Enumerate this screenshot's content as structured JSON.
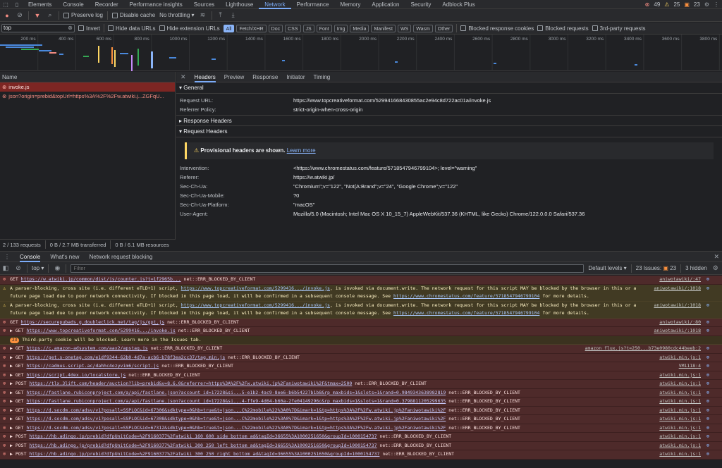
{
  "tabs": [
    "Elements",
    "Console",
    "Recorder",
    "Performance insights",
    "Sources",
    "Lighthouse",
    "Network",
    "Performance",
    "Memory",
    "Application",
    "Security",
    "Adblock Plus"
  ],
  "tab_active": "Network",
  "issues": {
    "errors": "49",
    "warnings": "25",
    "info": "23"
  },
  "toolbar": {
    "preserve_log": "Preserve log",
    "disable_cache": "Disable cache",
    "throttling": "No throttling"
  },
  "filter": {
    "value": "top",
    "invert": "Invert",
    "hide_data_urls": "Hide data URLs",
    "hide_extension_urls": "Hide extension URLs",
    "types": [
      "All",
      "Fetch/XHR",
      "Doc",
      "CSS",
      "JS",
      "Font",
      "Img",
      "Media",
      "Manifest",
      "WS",
      "Wasm",
      "Other"
    ],
    "blocked_response_cookies": "Blocked response cookies",
    "blocked_requests": "Blocked requests",
    "third_party": "3rd-party requests"
  },
  "timeline_ticks": [
    "200 ms",
    "400 ms",
    "600 ms",
    "800 ms",
    "1000 ms",
    "1200 ms",
    "1400 ms",
    "1600 ms",
    "1800 ms",
    "2000 ms",
    "2200 ms",
    "2400 ms",
    "2600 ms",
    "2800 ms",
    "3000 ms",
    "3200 ms",
    "3400 ms",
    "3600 ms",
    "3800 ms"
  ],
  "requests": {
    "header": "Name",
    "items": [
      {
        "name": "invoke.js"
      },
      {
        "name": "json?origin=prebid&topUrl=https%3A%2F%2Fw.atwiki.j...ZGFqU..."
      }
    ],
    "summary": {
      "requests": "2 / 133 requests",
      "transferred": "0 B / 2.7 MB transferred",
      "resources": "0 B / 6.1 MB resources"
    }
  },
  "details": {
    "tabs": [
      "Headers",
      "Preview",
      "Response",
      "Initiator",
      "Timing"
    ],
    "general_title": "General",
    "request_url_label": "Request URL:",
    "request_url": "https://www.topcreativeformat.com/529941668430855ac2e94c8d722ac01a/invoke.js",
    "referrer_policy_label": "Referrer Policy:",
    "referrer_policy": "strict-origin-when-cross-origin",
    "response_headers_title": "Response Headers",
    "request_headers_title": "Request Headers",
    "provisional_text": "Provisional headers are shown.",
    "provisional_link": "Learn more",
    "headers": [
      {
        "k": "Intervention:",
        "v": "<https://www.chromestatus.com/feature/5718547946799104>; level=\"warning\""
      },
      {
        "k": "Referer:",
        "v": "https://w.atwiki.jp/"
      },
      {
        "k": "Sec-Ch-Ua:",
        "v": "\"Chromium\";v=\"122\", \"Not(A:Brand\";v=\"24\", \"Google Chrome\";v=\"122\""
      },
      {
        "k": "Sec-Ch-Ua-Mobile:",
        "v": "?0"
      },
      {
        "k": "Sec-Ch-Ua-Platform:",
        "v": "\"macOS\""
      },
      {
        "k": "User-Agent:",
        "v": "Mozilla/5.0 (Macintosh; Intel Mac OS X 10_15_7) AppleWebKit/537.36 (KHTML, like Gecko) Chrome/122.0.0.0 Safari/537.36"
      }
    ]
  },
  "drawer": {
    "tabs": [
      "Console",
      "What's new",
      "Network request blocking"
    ],
    "context": "top",
    "filter_placeholder": "Filter",
    "levels": "Default levels",
    "issues_label": "23 Issues:",
    "issues_count": "23",
    "hidden": "3 hidden"
  },
  "console": [
    {
      "type": "err",
      "pre": "GET ",
      "url": "https://w.atwiki.jp/common/dist/js/counter.js?t=1f2965b...",
      "post": " net::ERR_BLOCKED_BY_CLIENT",
      "src": "aniwotawiki/:47"
    },
    {
      "type": "warn",
      "pre": "A parser-blocking, cross site (i.e. different eTLD+1) script, ",
      "url": "https://www.topcreativeformat.com/5299416.../invoke.js",
      "post": ", is invoked via document.write. The network request for this script MAY be blocked by the browser in this or a future page load due to poor network connectivity. If blocked in this page load, it will be confirmed in a subsequent console message. See ",
      "url2": "https://www.chromestatus.com/feature/5718547946799104",
      "post2": " for more details.",
      "src": "aniwotawiki/:1018"
    },
    {
      "type": "warn",
      "pre": "A parser-blocking, cross site (i.e. different eTLD+1) script, ",
      "url": "https://www.topcreativeformat.com/5299416.../invoke.js",
      "post": ", is invoked via document.write. The network request for this script MAY be blocked by the browser in this or a future page load due to poor network connectivity. If blocked in this page load, it will be confirmed in a subsequent console message. See ",
      "url2": "https://www.chromestatus.com/feature/5718547946799104",
      "post2": " for more details.",
      "src": "aniwotawiki/:1018"
    },
    {
      "type": "err",
      "pre": "GET ",
      "url": "https://securepubads.g.doubleclick.net/tag/js/gpt.js",
      "post": " net::ERR_BLOCKED_BY_CLIENT",
      "src": "aniwotawiki/:80"
    },
    {
      "type": "err",
      "pre": "▶ GET ",
      "url": "https://www.topcreativeformat.com/5299416.../invoke.js",
      "post": " net::ERR_BLOCKED_BY_CLIENT",
      "src": "aniwotawiki/:1018"
    },
    {
      "type": "info",
      "count": "23",
      "pre": "Third-party cookie will be blocked. Learn more in the Issues tab.",
      "url": "",
      "post": "",
      "src": ""
    },
    {
      "type": "err",
      "pre": "▶ GET ",
      "url": "https://c.amazon-adsystem.com/aax2/apstag.js",
      "post": " net::ERR_BLOCKED_BY_CLIENT",
      "src": "amazon_flux.js?t=250...b73e0980cdc44beeb:2"
    },
    {
      "type": "err",
      "pre": "▶ GET ",
      "url": "https://get.s-onetag.com/e1df9344-62b0-4d7a-acb6-b78f3ea2cc37/tag.min.js",
      "post": " net::ERR_BLOCKED_BY_CLIENT",
      "src": "atwiki.min.js:1"
    },
    {
      "type": "err",
      "pre": "▶ GET ",
      "url": "https://cadmus.script.ac/dahhc4ozyvim6/script.js",
      "post": " net::ERR_BLOCKED_BY_CLIENT",
      "src": "VM1118:4"
    },
    {
      "type": "err",
      "pre": "▶ GET ",
      "url": "https://script.4dex.io/localstore.js",
      "post": " net::ERR_BLOCKED_BY_CLIENT",
      "src": "atwiki.min.js:1"
    },
    {
      "type": "err",
      "pre": "▶ POST ",
      "url": "https://tlx.3lift.com/header/auction?lib=prebid&v=8.6.0&referrer=https%3A%2F%2Fw.atwiki.jp%2Faniwotawiki%2F&tmax=2500",
      "post": " net::ERR_BLOCKED_BY_CLIENT",
      "src": "atwiki.min.js:1"
    },
    {
      "type": "err",
      "pre": "▶ GET ",
      "url": "https://fastlane.rubiconproject.com/a/api/fastlane.json?account_id=17228&si...5-e1b2-4ac9-8ee6-b6b54227b1b8&rp_maxbids=1&slots=1&rand=0.9849343638982819",
      "post": " net::ERR_BLOCKED_BY_CLIENT",
      "src": "atwiki.min.js:1"
    },
    {
      "type": "err",
      "pre": "▶ GET ",
      "url": "https://fastlane.rubiconproject.com/a/api/fastlane.json?account_id=17228&si...4-ffe9-4d64-b60a-2fe04149296c&rp_maxbids=1&slots=1&rand=0.3798811205299635",
      "post": " net::ERR_BLOCKED_BY_CLIENT",
      "src": "atwiki.min.js:1"
    },
    {
      "type": "err",
      "pre": "▶ GET ",
      "url": "https://d.socdm.com/adsv/v1?posall=SSPLOC&id=67306&sdktype=0&hb=true&t=json...C%22mobile%22%3A0%7D&imark=1&tp=https%3A%2F%2Fw.atwiki.jp%2Faniwotawiki%2F",
      "post": " net::ERR_BLOCKED_BY_CLIENT",
      "src": "atwiki.min.js:1"
    },
    {
      "type": "err",
      "pre": "▶ GET ",
      "url": "https://d.socdm.com/adsv/v1?posall=SSPLOC&id=67308&sdktype=0&hb=true&t=json...C%22mobile%22%3A0%7D&imark=1&tp=https%3A%2F%2Fw.atwiki.jp%2Faniwotawiki%2F",
      "post": " net::ERR_BLOCKED_BY_CLIENT",
      "src": "atwiki.min.js:1"
    },
    {
      "type": "err",
      "pre": "▶ GET ",
      "url": "https://d.socdm.com/adsv/v1?posall=SSPLOC&id=67312&sdktype=0&hb=true&t=json...C%22mobile%22%3A0%7D&imark=1&tp=https%3A%2F%2Fw.atwiki.jp%2Faniwotawiki%2F",
      "post": " net::ERR_BLOCKED_BY_CLIENT",
      "src": "atwiki.min.js:1"
    },
    {
      "type": "err",
      "pre": "▶ POST ",
      "url": "https://hb.adingo.jp/prebid?dfpUnitCode=%2F9160377%2Fatwiki_160_600_side_bottom_ad&tagId=36655%3A1000251650&groupId=1000154737",
      "post": " net::ERR_BLOCKED_BY_CLIENT",
      "src": "atwiki.min.js:1"
    },
    {
      "type": "err",
      "pre": "▶ POST ",
      "url": "https://hb.adingo.jp/prebid?dfpUnitCode=%2F9160377%2Fatwiki_300_250_left_bottom_ad&tagId=36655%3A1000251650&groupId=1000154737",
      "post": " net::ERR_BLOCKED_BY_CLIENT",
      "src": "atwiki.min.js:1"
    },
    {
      "type": "err",
      "pre": "▶ POST ",
      "url": "https://hb.adingo.jp/prebid?dfpUnitCode=%2F9160377%2Fatwiki_300_250_right_bottom_ad&tagId=36655%3A1000251650&groupId=1000154737",
      "post": " net::ERR_BLOCKED_BY_CLIENT",
      "src": "atwiki.min.js:1"
    }
  ]
}
